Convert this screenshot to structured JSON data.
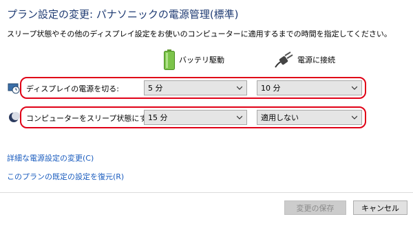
{
  "header": {
    "title": "プラン設定の変更: パナソニックの電源管理(標準)",
    "description": "スリープ状態やその他のディスプレイ設定をお使いのコンピューターに適用するまでの時間を指定してください。"
  },
  "columns": {
    "battery": {
      "label": "バッテリ駆動",
      "icon": "battery-icon"
    },
    "plugged": {
      "label": "電源に接続",
      "icon": "power-plug-icon"
    }
  },
  "rows": [
    {
      "label": "ディスプレイの電源を切る:",
      "icon": "display-clock-icon",
      "battery_value": "5 分",
      "plugged_value": "10 分"
    },
    {
      "label": "コンピューターをスリープ状態にする:",
      "icon": "sleep-moon-icon",
      "battery_value": "15 分",
      "plugged_value": "適用しない"
    }
  ],
  "links": {
    "advanced": "詳細な電源設定の変更(C)",
    "restore": "このプランの既定の設定を復元(R)"
  },
  "buttons": {
    "save": "変更の保存",
    "cancel": "キャンセル"
  },
  "colors": {
    "highlight": "#e00016",
    "link": "#1a5cbf",
    "title": "#1f3b73"
  }
}
